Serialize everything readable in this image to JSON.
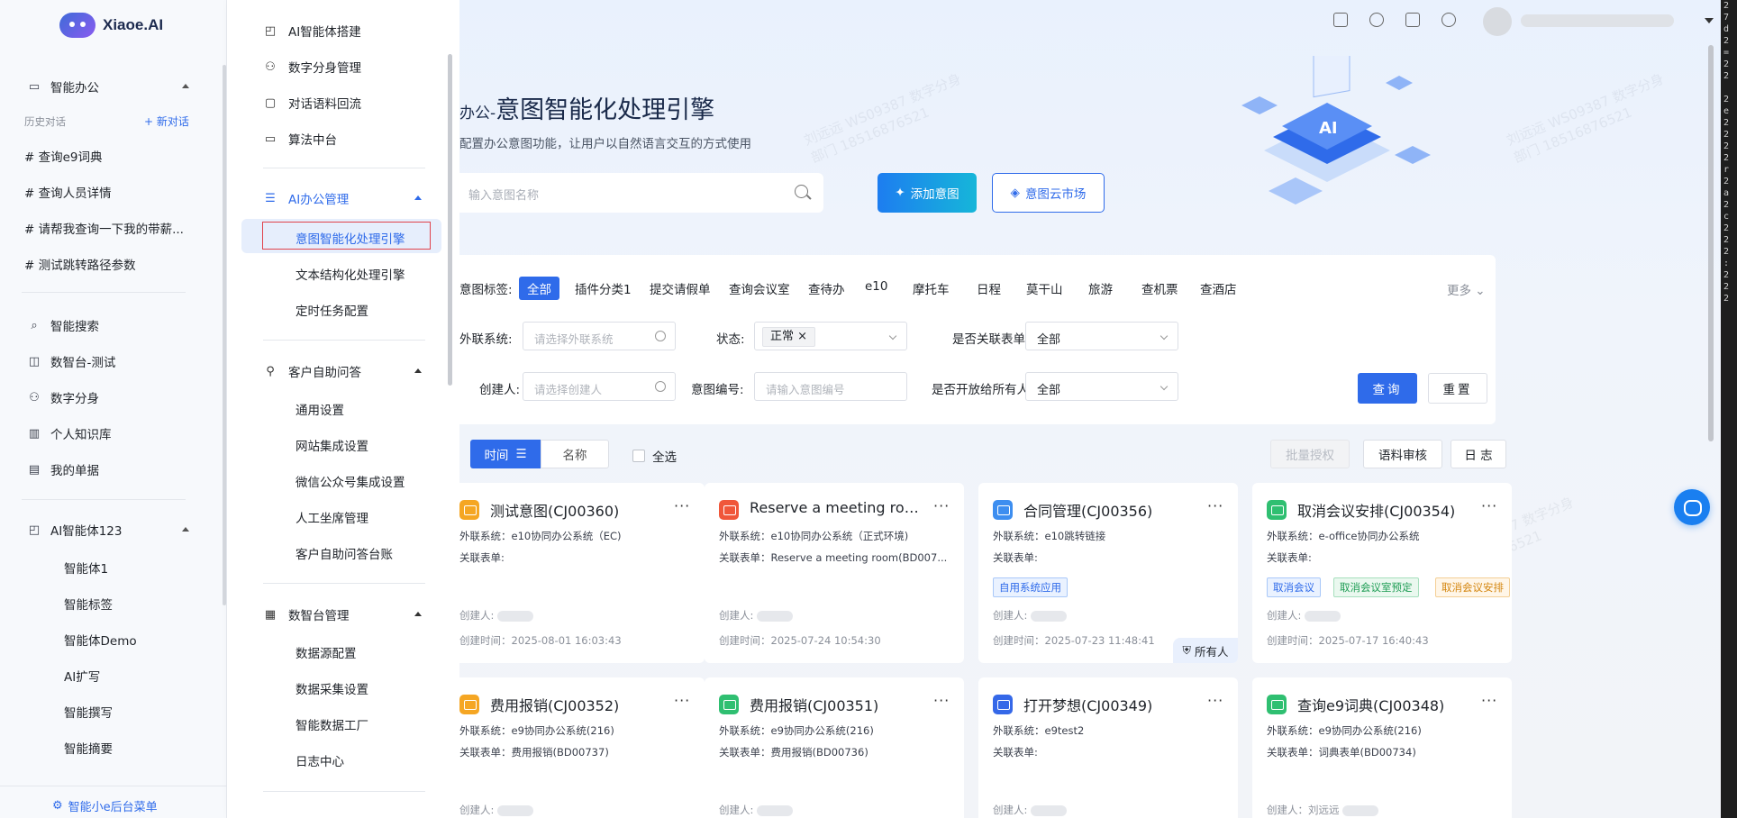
{
  "app": {
    "logo_text": "Xiaoe.AI"
  },
  "left_sidebar": {
    "section_smart_office": "智能办公",
    "history_label": "历史对话",
    "new_chat": "+ 新对话",
    "history": [
      "# 查询e9词典",
      "# 查询人员详情",
      "# 请帮我查询一下我的带薪...",
      "# 测试跳转路径参数"
    ],
    "nav": [
      "智能搜索",
      "数智台-测试",
      "数字分身",
      "个人知识库",
      "我的单据"
    ],
    "agent_group": "AI智能体123",
    "agent_items": [
      "智能体1",
      "智能标签",
      "智能体Demo",
      "AI扩写",
      "智能撰写",
      "智能摘要"
    ],
    "footer": "智能小e后台菜单"
  },
  "menu": {
    "top_items": [
      "AI智能体搭建",
      "数字分身管理",
      "对话语料回流",
      "算法中台"
    ],
    "group_office": "AI办公管理",
    "office_items": [
      "意图智能化处理引擎",
      "文本结构化处理引擎",
      "定时任务配置"
    ],
    "group_customer": "客户自助问答",
    "customer_items": [
      "通用设置",
      "网站集成设置",
      "微信公众号集成设置",
      "人工坐席管理",
      "客户自助问答台账"
    ],
    "group_data": "数智台管理",
    "data_items": [
      "数据源配置",
      "数据采集设置",
      "智能数据工厂",
      "日志中心"
    ]
  },
  "header": {
    "title_prefix": "办公-",
    "title": "意图智能化处理引擎",
    "subtitle": "配置办公意图功能，让用户以自然语言交互的方式使用",
    "search_placeholder": "输入意图名称",
    "btn_add": "添加意图",
    "btn_market": "意图云市场",
    "hero_badge": "AI"
  },
  "filter": {
    "tag_label": "意图标签:",
    "tags": [
      "全部",
      "插件分类1",
      "提交请假单",
      "查询会议室",
      "查待办",
      "e10",
      "摩托车",
      "日程",
      "莫干山",
      "旅游",
      "查机票",
      "查酒店"
    ],
    "more": "更多",
    "ext_label": "外联系统:",
    "ext_placeholder": "请选择外联系统",
    "status_label": "状态:",
    "status_value": "正常 ×",
    "linked_label": "是否关联表单:",
    "linked_value": "全部",
    "creator_label": "创建人:",
    "creator_placeholder": "请选择创建人",
    "code_label": "意图编号:",
    "code_placeholder": "请输入意图编号",
    "open_label": "是否开放给所有人:",
    "open_value": "全部",
    "btn_query": "查询",
    "btn_reset": "重置"
  },
  "sortbar": {
    "time": "时间",
    "name": "名称",
    "select_all": "全选",
    "batch_auth": "批量授权",
    "corpus_review": "语料审核",
    "log": "日 志"
  },
  "cards": [
    {
      "title": "测试意图(CJ00360)",
      "system": "外联系统：e10协同办公系统（EC)",
      "form": "关联表单:",
      "creator": "创建人:",
      "time": "创建时间：2025-08-01 16:03:43",
      "color": "#f5a623",
      "tags": [],
      "owner": ""
    },
    {
      "title": "Reserve a meeting roo...",
      "system": "外联系统：e10协同办公系统（正式环境)",
      "form": "关联表单：Reserve a meeting room(BD007...",
      "creator": "创建人:",
      "time": "创建时间：2025-07-24 10:54:30",
      "color": "#f0573a",
      "tags": [],
      "owner": ""
    },
    {
      "title": "合同管理(CJ00356)",
      "system": "外联系统：e10跳转链接",
      "form": "关联表单:",
      "creator": "创建人:",
      "time": "创建时间：2025-07-23 11:48:41",
      "color": "#3d8ef0",
      "tags": [
        {
          "text": "自用系统应用",
          "c": "blue"
        }
      ],
      "owner": "所有人"
    },
    {
      "title": "取消会议安排(CJ00354)",
      "system": "外联系统：e-office协同办公系统",
      "form": "关联表单:",
      "creator": "创建人:",
      "time": "创建时间：2025-07-17 16:40:43",
      "color": "#2fbf71",
      "tags": [
        {
          "text": "取消会议",
          "c": "blue"
        },
        {
          "text": "取消会议室预定",
          "c": "green"
        },
        {
          "text": "取消会议安排",
          "c": "orange"
        }
      ],
      "owner": ""
    },
    {
      "title": "费用报销(CJ00352)",
      "system": "外联系统：e9协同办公系统(216)",
      "form": "关联表单：费用报销(BD00737)",
      "creator": "创建人:",
      "time": "",
      "color": "#f5a623",
      "tags": [],
      "owner": ""
    },
    {
      "title": "费用报销(CJ00351)",
      "system": "外联系统：e9协同办公系统(216)",
      "form": "关联表单：费用报销(BD00736)",
      "creator": "创建人:",
      "time": "",
      "color": "#2fbf71",
      "tags": [],
      "owner": ""
    },
    {
      "title": "打开梦想(CJ00349)",
      "system": "外联系统：e9test2",
      "form": "关联表单:",
      "creator": "创建人:",
      "time": "",
      "color": "#3568e8",
      "tags": [],
      "owner": ""
    },
    {
      "title": "查询e9词典(CJ00348)",
      "system": "外联系统：e9协同办公系统(216)",
      "form": "关联表单：词典表单(BD00734)",
      "creator": "创建人：刘远远",
      "time": "",
      "color": "#2fbf71",
      "tags": [],
      "owner": ""
    }
  ],
  "watermark": [
    "刘远远 WS09387 数字分身",
    "部门 18516876521"
  ],
  "terminal": [
    "2",
    "7",
    "d",
    "2",
    "=",
    "2",
    "2",
    "",
    "2",
    "e",
    "2",
    "2",
    "2",
    "2",
    "r",
    "2",
    "a",
    "2",
    "c",
    "2",
    "2",
    "2",
    ":",
    "2",
    "2",
    "2"
  ]
}
